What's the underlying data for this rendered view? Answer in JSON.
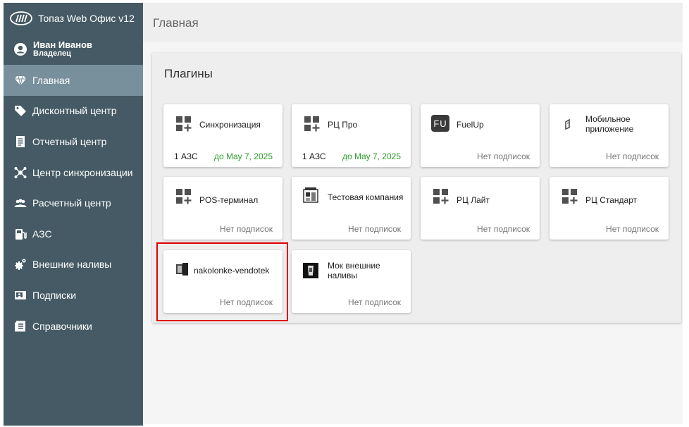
{
  "app": {
    "title": "Топаз Web Офис v12"
  },
  "user": {
    "name": "Иван Иванов",
    "role": "Владелец"
  },
  "nav": [
    {
      "label": "Главная",
      "icon": "diamond-icon",
      "active": true
    },
    {
      "label": "Дисконтный центр",
      "icon": "tag-icon"
    },
    {
      "label": "Отчетный центр",
      "icon": "report-icon"
    },
    {
      "label": "Центр синхронизации",
      "icon": "sync-hub-icon"
    },
    {
      "label": "Расчетный центр",
      "icon": "people-icon"
    },
    {
      "label": "АЗС",
      "icon": "fuel-pump-icon"
    },
    {
      "label": "Внешние наливы",
      "icon": "cogs-icon"
    },
    {
      "label": "Подписки",
      "icon": "id-card-icon"
    },
    {
      "label": "Справочники",
      "icon": "book-icon"
    }
  ],
  "header": {
    "title": "Главная"
  },
  "plugins": {
    "title": "Плагины",
    "cards": [
      {
        "title": "Синхронизация",
        "icon": "plugin-grid-icon",
        "left": "1 АЗС",
        "right": "до May 7, 2025"
      },
      {
        "title": "РЦ Про",
        "icon": "plugin-grid-icon",
        "left": "1 АЗС",
        "right": "до May 7, 2025"
      },
      {
        "title": "FuelUp",
        "icon": "fuelup-logo-icon",
        "logo_text": "FU",
        "right": "Нет подписок"
      },
      {
        "title": "Мобильное приложение",
        "icon": "mobile-app-icon",
        "right": "Нет подписок"
      },
      {
        "title": "POS-терминал",
        "icon": "plugin-grid-icon",
        "right": "Нет подписок"
      },
      {
        "title": "Тестовая компания",
        "icon": "company-logo-icon",
        "right": "Нет подписок"
      },
      {
        "title": "РЦ Лайт",
        "icon": "plugin-grid-icon",
        "right": "Нет подписок"
      },
      {
        "title": "РЦ Стандарт",
        "icon": "plugin-grid-icon",
        "right": "Нет подписок"
      },
      {
        "title": "nakolonke-vendotek",
        "icon": "terminal-device-icon",
        "right": "Нет подписок"
      },
      {
        "title": "Мок внешние наливы",
        "icon": "dark-logo-icon",
        "right": "Нет подписок"
      }
    ]
  },
  "colors": {
    "sidebar": "#455a64",
    "active": "#78909c",
    "green": "#2e9d2e",
    "highlight": "#e00000"
  }
}
